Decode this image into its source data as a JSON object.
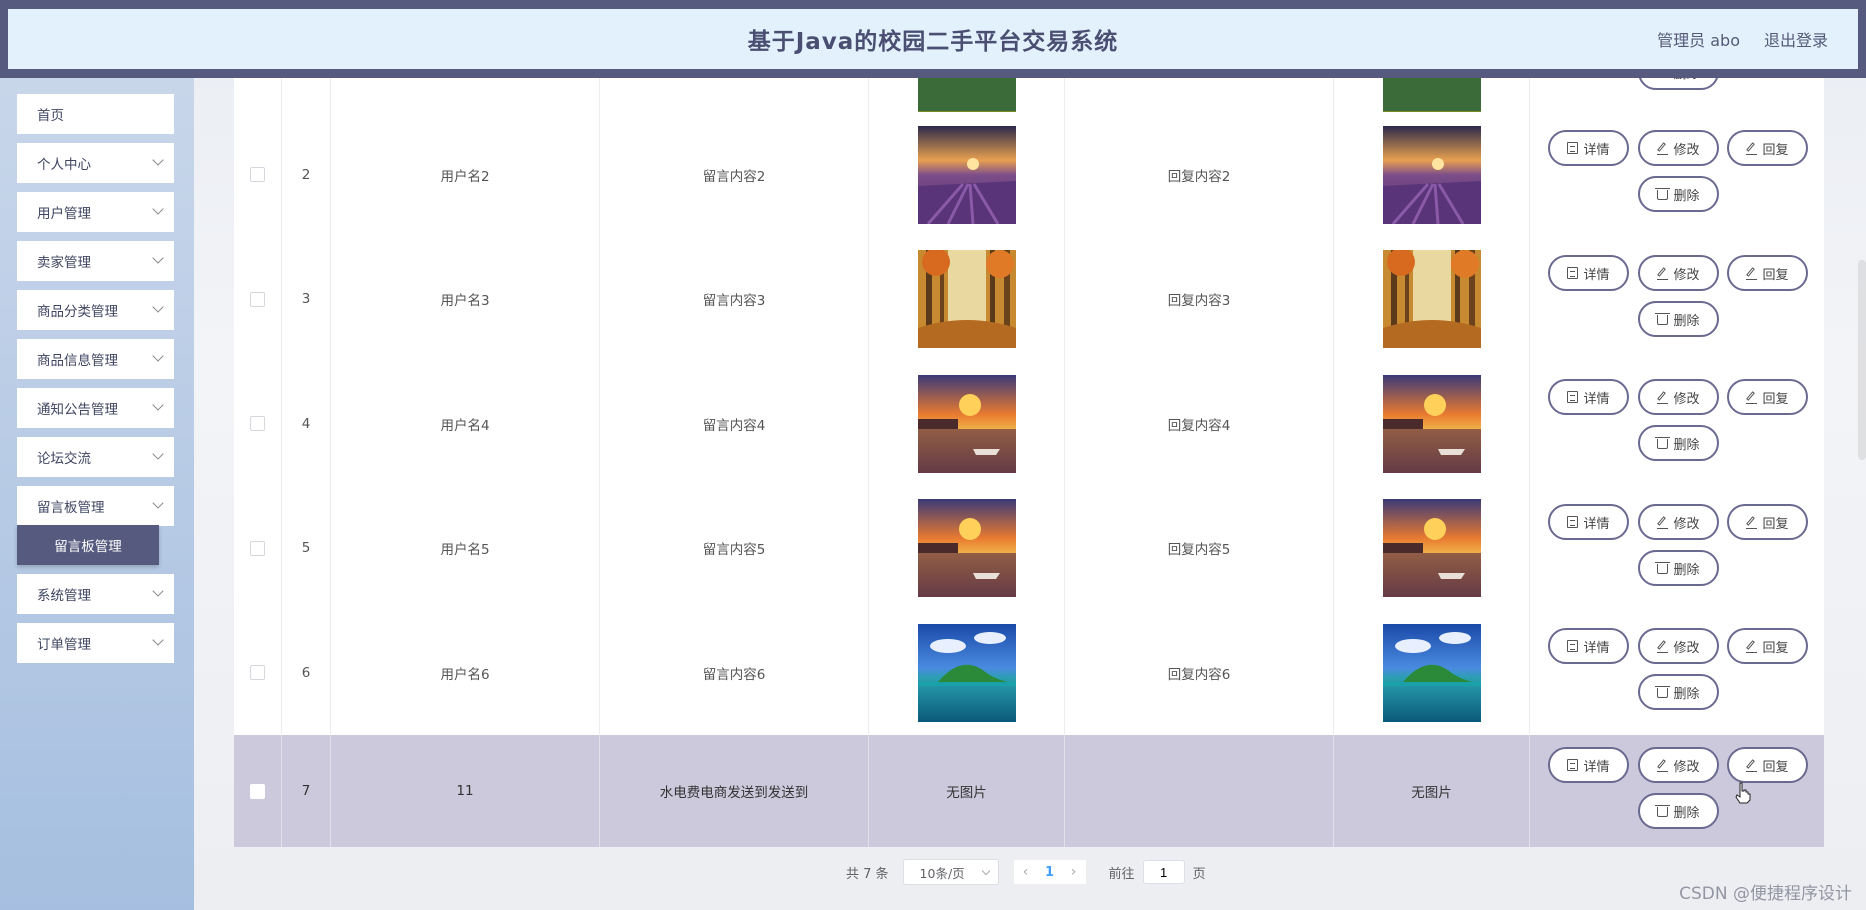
{
  "header": {
    "title": "基于Java的校园二手平台交易系统",
    "user": "管理员 abo",
    "logout": "退出登录"
  },
  "sidebar": {
    "items": [
      {
        "label": "首页",
        "has_arrow": false
      },
      {
        "label": "个人中心",
        "has_arrow": true
      },
      {
        "label": "用户管理",
        "has_arrow": true
      },
      {
        "label": "卖家管理",
        "has_arrow": true
      },
      {
        "label": "商品分类管理",
        "has_arrow": true
      },
      {
        "label": "商品信息管理",
        "has_arrow": true
      },
      {
        "label": "通知公告管理",
        "has_arrow": true
      },
      {
        "label": "论坛交流",
        "has_arrow": true
      },
      {
        "label": "留言板管理",
        "has_arrow": true
      },
      {
        "label": "系统管理",
        "has_arrow": true
      },
      {
        "label": "订单管理",
        "has_arrow": true
      }
    ],
    "active_sub": "留言板管理"
  },
  "buttons": {
    "detail": "详情",
    "edit": "修改",
    "reply": "回复",
    "delete": "删除"
  },
  "rows": [
    {
      "index": "",
      "username": "",
      "content": "",
      "image": "forest",
      "reply": "",
      "reply_image": "forest",
      "partial": true
    },
    {
      "index": "2",
      "username": "用户名2",
      "content": "留言内容2",
      "image": "lavender",
      "reply": "回复内容2",
      "reply_image": "lavender"
    },
    {
      "index": "3",
      "username": "用户名3",
      "content": "留言内容3",
      "image": "autumn",
      "reply": "回复内容3",
      "reply_image": "autumn"
    },
    {
      "index": "4",
      "username": "用户名4",
      "content": "留言内容4",
      "image": "sunset",
      "reply": "回复内容4",
      "reply_image": "sunset"
    },
    {
      "index": "5",
      "username": "用户名5",
      "content": "留言内容5",
      "image": "sunset",
      "reply": "回复内容5",
      "reply_image": "sunset"
    },
    {
      "index": "6",
      "username": "用户名6",
      "content": "留言内容6",
      "image": "island",
      "reply": "回复内容6",
      "reply_image": "island"
    },
    {
      "index": "7",
      "username": "11",
      "content": "水电费电商发送到发送到",
      "image_text": "无图片",
      "reply": "",
      "reply_image_text": "无图片",
      "selected": true
    }
  ],
  "pagination": {
    "total": "共 7 条",
    "page_size": "10条/页",
    "current": "1",
    "goto_label": "前往",
    "goto_value": "1",
    "page_suffix": "页"
  },
  "watermark": "CSDN @便捷程序设计"
}
